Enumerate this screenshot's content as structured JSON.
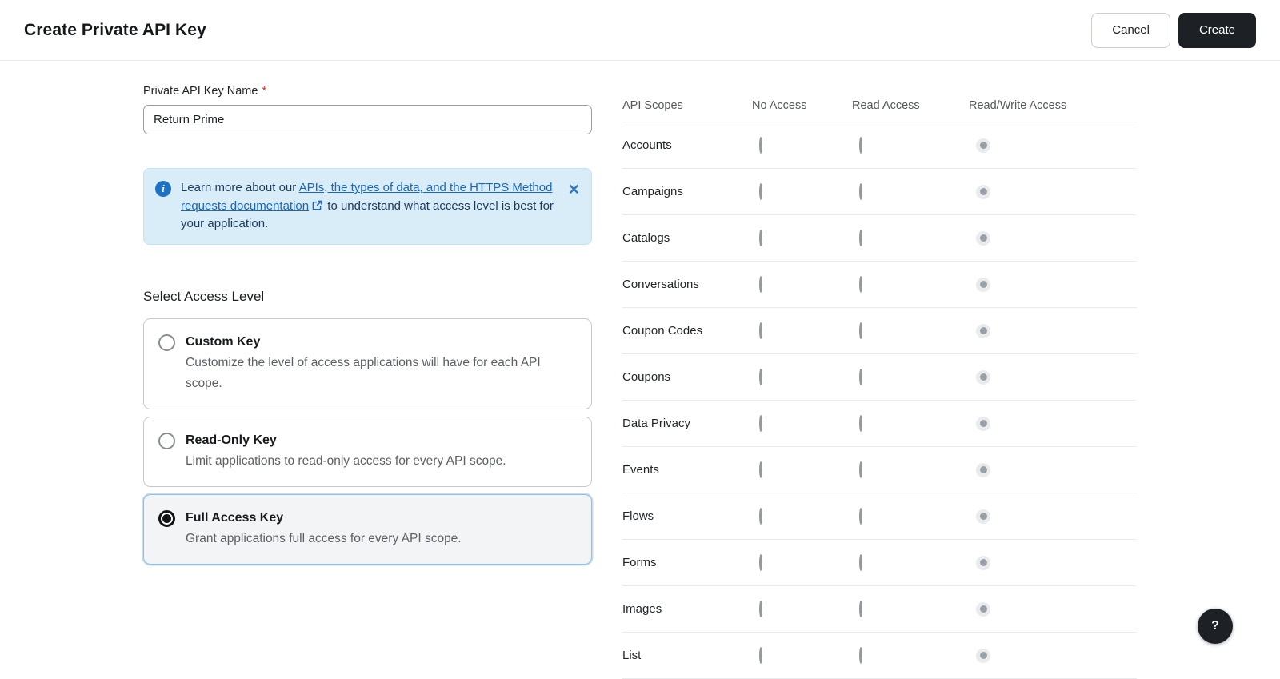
{
  "header": {
    "title": "Create Private API Key",
    "cancel_label": "Cancel",
    "create_label": "Create"
  },
  "form": {
    "name_label": "Private API Key Name",
    "required_marker": "*",
    "name_value": "Return Prime",
    "banner": {
      "text_before": "Learn more about our ",
      "link_text": "APIs, the types of data, and the HTTPS Method requests documentation",
      "text_after": " to understand what access level is best for your application.",
      "close_glyph": "✕",
      "info_glyph": "i"
    },
    "access_level_heading": "Select Access Level",
    "options": [
      {
        "id": "custom-key",
        "title": "Custom Key",
        "description": "Customize the level of access applications will have for each API scope.",
        "selected": false
      },
      {
        "id": "read-only-key",
        "title": "Read-Only Key",
        "description": "Limit applications to read-only access for every API scope.",
        "selected": false
      },
      {
        "id": "full-access-key",
        "title": "Full Access Key",
        "description": "Grant applications full access for every API scope.",
        "selected": true
      }
    ]
  },
  "scopes": {
    "headers": {
      "scope": "API Scopes",
      "no_access": "No Access",
      "read": "Read Access",
      "read_write": "Read/Write Access"
    },
    "selected_column": "read_write",
    "radio_state": "disabled-selected",
    "rows": [
      "Accounts",
      "Campaigns",
      "Catalogs",
      "Conversations",
      "Coupon Codes",
      "Coupons",
      "Data Privacy",
      "Events",
      "Flows",
      "Forms",
      "Images",
      "List"
    ]
  },
  "help": {
    "label": "?"
  },
  "colors": {
    "accent_blue": "#1a66c2",
    "banner_bg": "#d9edf9",
    "banner_text": "#1d3a5c",
    "selected_card_border": "#8fc0ec",
    "selected_card_bg": "#f3f4f6",
    "create_button_bg": "#1d2025",
    "required_red": "#d62b1f",
    "disabled_radio_dot": "#9aa0a7"
  }
}
